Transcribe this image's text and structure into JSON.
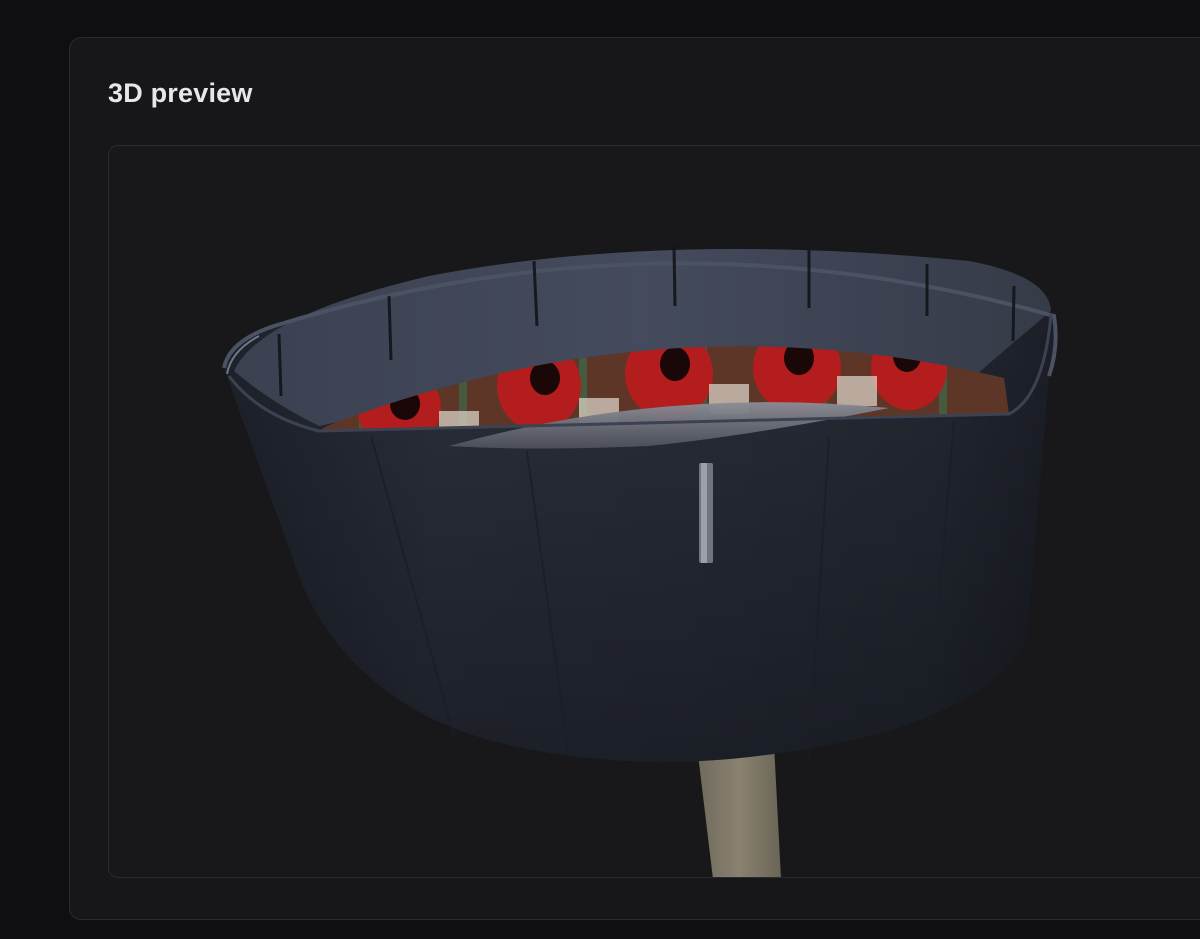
{
  "panel": {
    "title": "3D preview"
  },
  "preview": {
    "object": "zoetrope",
    "frames": [
      "elmo",
      "elmo",
      "elmo",
      "elmo",
      "elmo"
    ],
    "colors": {
      "drum": "#2b303c",
      "stand": "#8a8270",
      "figure": "#b31d1d",
      "backdrop": "#6e2a22"
    }
  }
}
